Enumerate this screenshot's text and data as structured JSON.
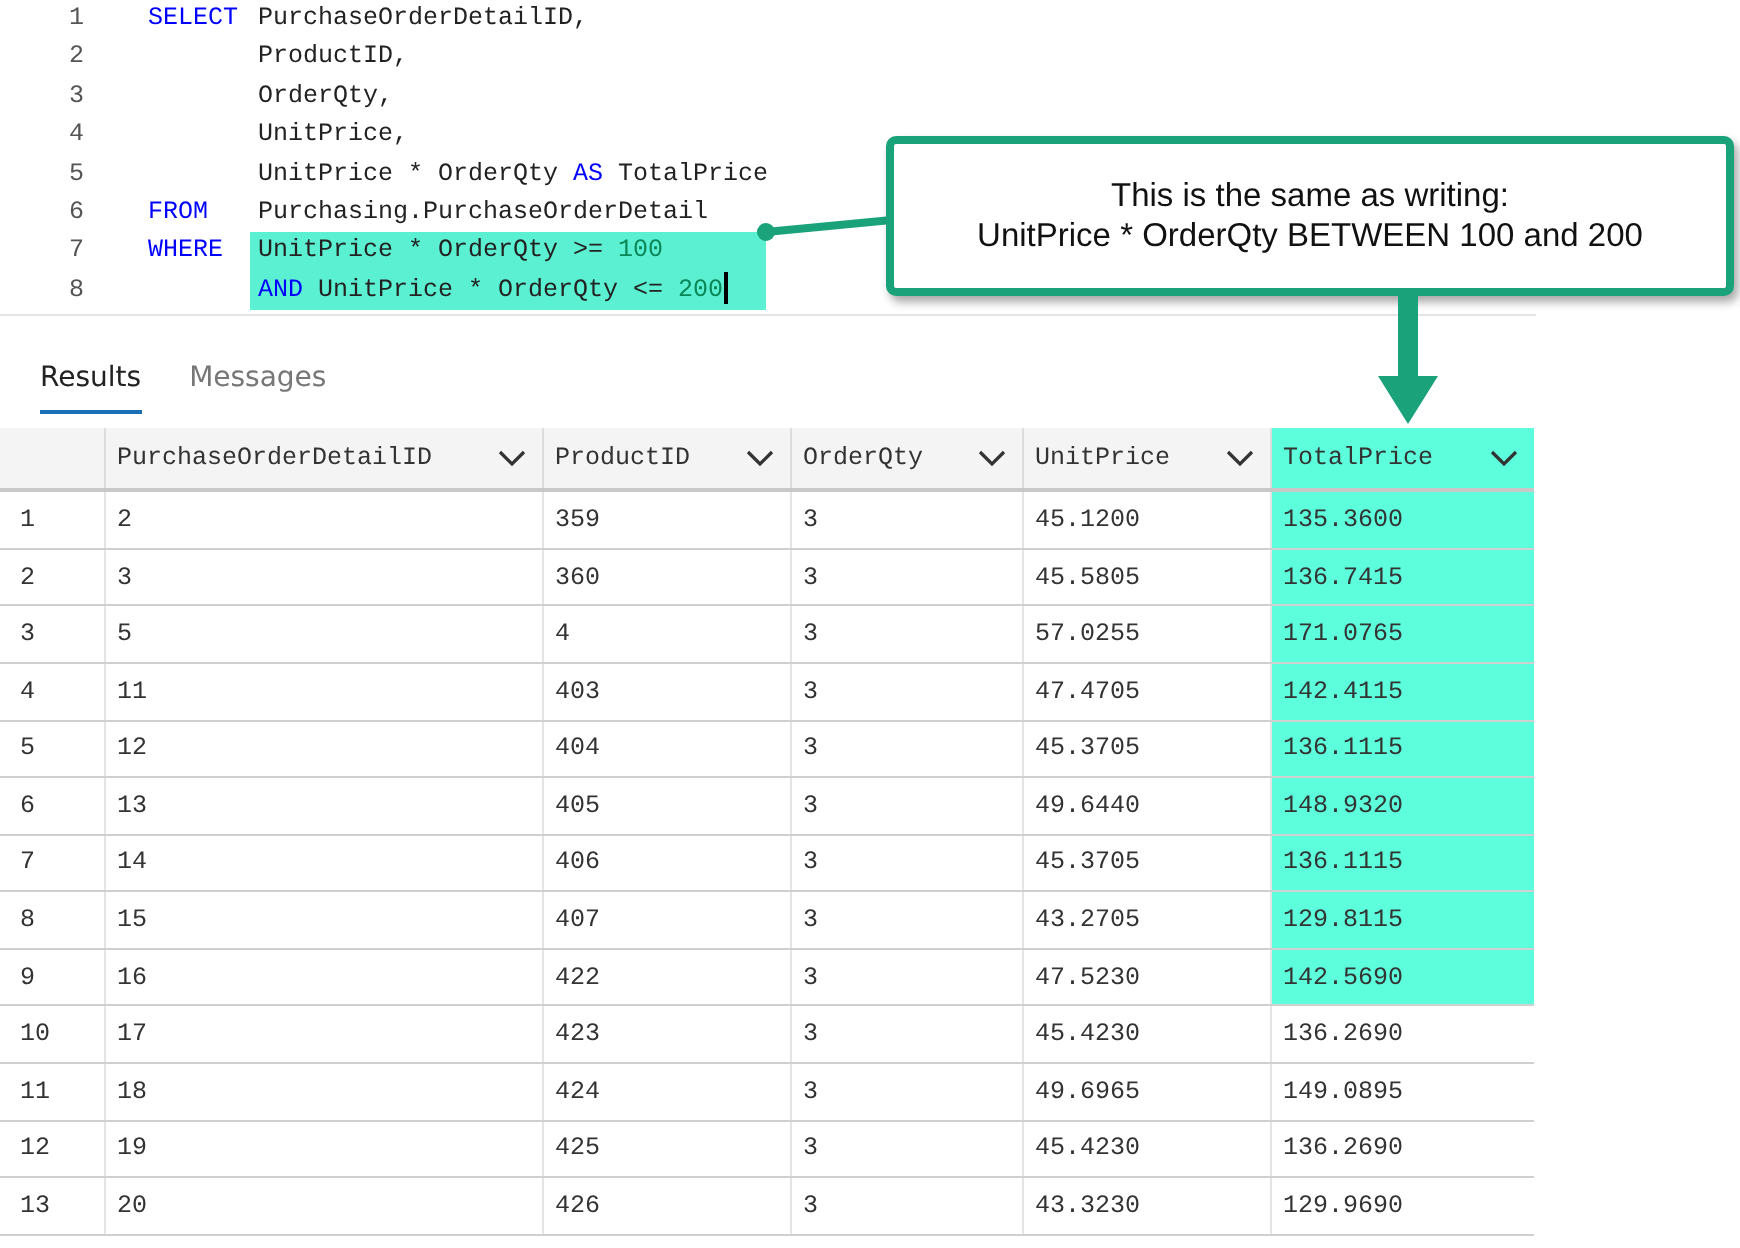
{
  "editor": {
    "lines": [
      {
        "number": "1",
        "keyword": "SELECT",
        "code": [
          {
            "text": "PurchaseOrderDetailID,",
            "kind": "text"
          }
        ],
        "highlighted": false
      },
      {
        "number": "2",
        "code": [
          {
            "text": "ProductID,",
            "kind": "text"
          }
        ],
        "highlighted": false
      },
      {
        "number": "3",
        "code": [
          {
            "text": "OrderQty,",
            "kind": "text"
          }
        ],
        "highlighted": false
      },
      {
        "number": "4",
        "code": [
          {
            "text": "UnitPrice,",
            "kind": "text"
          }
        ],
        "highlighted": false
      },
      {
        "number": "5",
        "code": [
          {
            "text": "UnitPrice * OrderQty ",
            "kind": "text"
          },
          {
            "text": "AS",
            "kind": "keyword"
          },
          {
            "text": " TotalPrice",
            "kind": "text"
          }
        ],
        "highlighted": false
      },
      {
        "number": "6",
        "keyword": "FROM",
        "code": [
          {
            "text": "Purchasing.PurchaseOrderDetail",
            "kind": "text"
          }
        ],
        "highlighted": false
      },
      {
        "number": "7",
        "keyword": "WHERE",
        "code": [
          {
            "text": "UnitPrice * OrderQty >= ",
            "kind": "text"
          },
          {
            "text": "100",
            "kind": "number"
          }
        ],
        "highlighted": true
      },
      {
        "number": "8",
        "code": [
          {
            "text": "AND",
            "kind": "keyword"
          },
          {
            "text": " UnitPrice * OrderQty <= ",
            "kind": "text"
          },
          {
            "text": "200",
            "kind": "number"
          }
        ],
        "highlighted": true,
        "cursor": true
      }
    ]
  },
  "callout": {
    "lines": [
      "This is the same as writing:",
      "UnitPrice * OrderQty BETWEEN 100 and 200"
    ]
  },
  "tabs": [
    {
      "label": "Results",
      "selected": true
    },
    {
      "label": "Messages",
      "selected": false
    }
  ],
  "table": {
    "columns": [
      {
        "label": "PurchaseOrderDetailID",
        "highlighted": false
      },
      {
        "label": "ProductID",
        "highlighted": false
      },
      {
        "label": "OrderQty",
        "highlighted": false
      },
      {
        "label": "UnitPrice",
        "highlighted": false
      },
      {
        "label": "TotalPrice",
        "highlighted": true
      }
    ],
    "rows": [
      {
        "number": "1",
        "cells": [
          "2",
          "359",
          "3",
          "45.1200",
          "135.3600"
        ],
        "highlighted": true
      },
      {
        "number": "2",
        "cells": [
          "3",
          "360",
          "3",
          "45.5805",
          "136.7415"
        ],
        "highlighted": true
      },
      {
        "number": "3",
        "cells": [
          "5",
          "4",
          "3",
          "57.0255",
          "171.0765"
        ],
        "highlighted": true
      },
      {
        "number": "4",
        "cells": [
          "11",
          "403",
          "3",
          "47.4705",
          "142.4115"
        ],
        "highlighted": true
      },
      {
        "number": "5",
        "cells": [
          "12",
          "404",
          "3",
          "45.3705",
          "136.1115"
        ],
        "highlighted": true
      },
      {
        "number": "6",
        "cells": [
          "13",
          "405",
          "3",
          "49.6440",
          "148.9320"
        ],
        "highlighted": true
      },
      {
        "number": "7",
        "cells": [
          "14",
          "406",
          "3",
          "45.3705",
          "136.1115"
        ],
        "highlighted": true
      },
      {
        "number": "8",
        "cells": [
          "15",
          "407",
          "3",
          "43.2705",
          "129.8115"
        ],
        "highlighted": true
      },
      {
        "number": "9",
        "cells": [
          "16",
          "422",
          "3",
          "47.5230",
          "142.5690"
        ],
        "highlighted": true
      },
      {
        "number": "10",
        "cells": [
          "17",
          "423",
          "3",
          "45.4230",
          "136.2690"
        ],
        "highlighted": false
      },
      {
        "number": "11",
        "cells": [
          "18",
          "424",
          "3",
          "49.6965",
          "149.0895"
        ],
        "highlighted": false
      },
      {
        "number": "12",
        "cells": [
          "19",
          "425",
          "3",
          "45.4230",
          "136.2690"
        ],
        "highlighted": false
      },
      {
        "number": "13",
        "cells": [
          "20",
          "426",
          "3",
          "43.3230",
          "129.9690"
        ],
        "highlighted": false
      }
    ]
  }
}
